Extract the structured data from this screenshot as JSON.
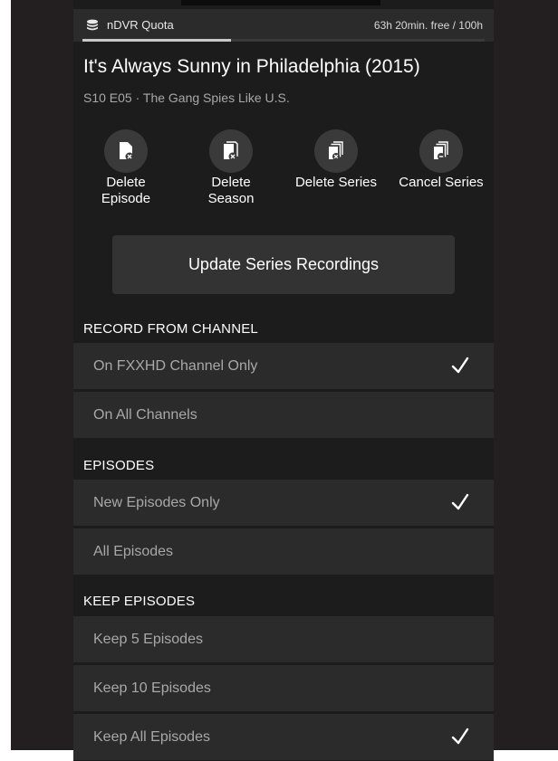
{
  "quota": {
    "label": "nDVR Quota",
    "free_text": "63h 20min. free / 100h",
    "used_fraction": 0.37,
    "icon": "database-icon"
  },
  "show": {
    "title": "It's Always Sunny in Philadelphia (2015)",
    "subtitle": "S10 E05 · The Gang Spies Like U.S."
  },
  "actions": [
    {
      "label_line1": "Delete",
      "label_line2": "Episode",
      "icon": "delete-episode-icon"
    },
    {
      "label_line1": "Delete",
      "label_line2": "Season",
      "icon": "delete-season-icon"
    },
    {
      "label_line1": "Delete Series",
      "label_line2": "",
      "icon": "delete-series-icon"
    },
    {
      "label_line1": "Cancel Series",
      "label_line2": "",
      "icon": "cancel-series-icon"
    }
  ],
  "update_button": "Update Series Recordings",
  "sections": {
    "channel": {
      "header": "RECORD FROM CHANNEL",
      "options": [
        {
          "label": "On FXXHD Channel Only",
          "checked": true
        },
        {
          "label": "On All Channels",
          "checked": false
        }
      ]
    },
    "episodes": {
      "header": "EPISODES",
      "options": [
        {
          "label": "New Episodes Only",
          "checked": true
        },
        {
          "label": "All Episodes",
          "checked": false
        }
      ]
    },
    "keep": {
      "header": "KEEP EPISODES",
      "options": [
        {
          "label": "Keep 5 Episodes",
          "checked": false
        },
        {
          "label": "Keep 10 Episodes",
          "checked": false
        },
        {
          "label": "Keep All Episodes",
          "checked": true
        }
      ]
    }
  },
  "colors": {
    "background": "#1c1c1c",
    "row": "#2b2b2b",
    "text": "#ffffff",
    "muted_text": "#a8a8a8",
    "quota_fill": "#c8c8c8"
  }
}
